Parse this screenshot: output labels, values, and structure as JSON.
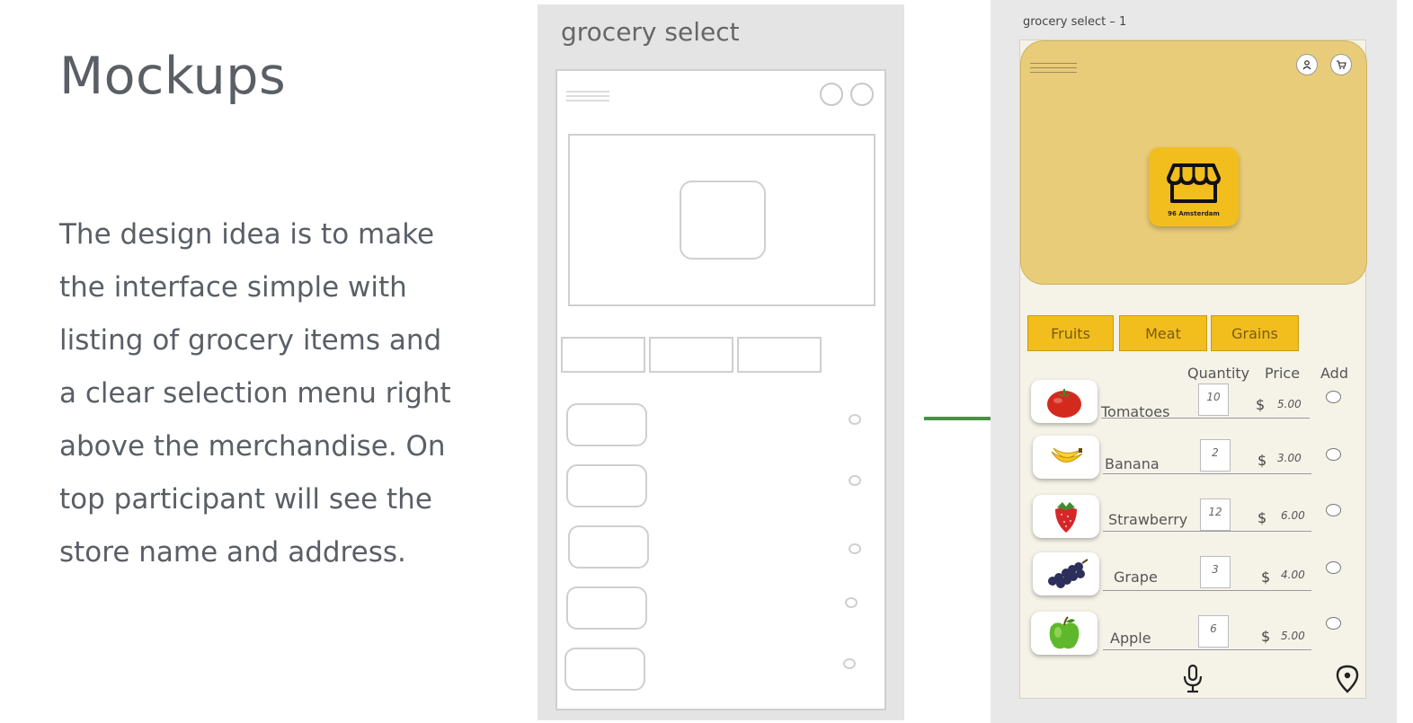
{
  "slide": {
    "title": "Mockups",
    "description_lines": [
      "The design idea is to make",
      "the interface simple with",
      "listing of grocery items and",
      "a clear selection menu right",
      "above the merchandise. On",
      "top participant will see the",
      "store name and address."
    ]
  },
  "wireframe": {
    "title": "grocery select"
  },
  "mockup": {
    "frame_label": "grocery select – 1",
    "store_name": "96 Amsterdam",
    "accent_color": "#f2be1e",
    "hero_color": "#e9cc79",
    "connector_color": "#3a9a44",
    "header_icons": [
      "user-icon",
      "cart-icon"
    ],
    "tabs": [
      "Fruits",
      "Meat",
      "Grains"
    ],
    "columns": {
      "quantity": "Quantity",
      "price": "Price",
      "add": "Add"
    },
    "currency": "$",
    "items": [
      {
        "name": "Tomatoes",
        "qty": "10",
        "price": "5.00",
        "icon": "tomato-icon"
      },
      {
        "name": "Banana",
        "qty": "2",
        "price": "3.00",
        "icon": "banana-icon"
      },
      {
        "name": "Strawberry",
        "qty": "12",
        "price": "6.00",
        "icon": "strawberry-icon"
      },
      {
        "name": "Grape",
        "qty": "3",
        "price": "4.00",
        "icon": "grape-icon"
      },
      {
        "name": "Apple",
        "qty": "6",
        "price": "5.00",
        "icon": "apple-icon"
      }
    ],
    "footer_icons": [
      "microphone-icon",
      "location-pin-icon"
    ]
  }
}
